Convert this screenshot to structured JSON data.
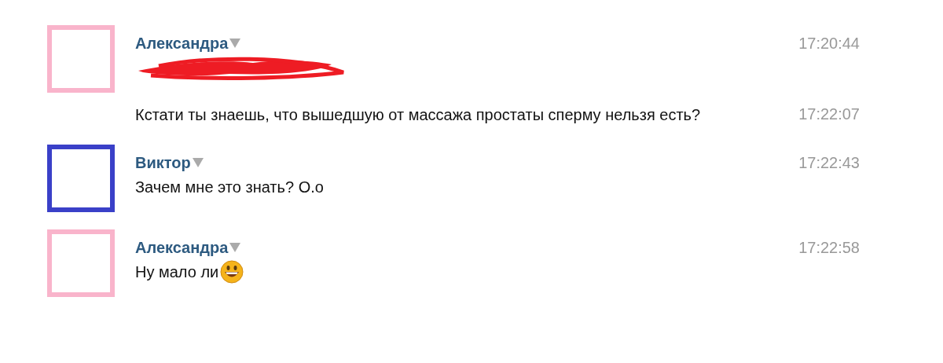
{
  "messages": [
    {
      "author": "Александра",
      "color": "#f9b4cb",
      "entries": [
        {
          "kind": "redacted",
          "time": "17:20:44"
        },
        {
          "kind": "text",
          "text": "Кстати ты знаешь, что вышедшую от массажа простаты сперму нельзя есть?",
          "time": "17:22:07"
        }
      ]
    },
    {
      "author": "Виктор",
      "color": "#3a40c8",
      "entries": [
        {
          "kind": "text",
          "text": "Зачем мне это знать? O.o",
          "time": "17:22:43"
        }
      ]
    },
    {
      "author": "Александра",
      "color": "#f9b4cb",
      "entries": [
        {
          "kind": "emoji_text",
          "text": "Ну мало ли",
          "time": "17:22:58"
        }
      ]
    }
  ]
}
